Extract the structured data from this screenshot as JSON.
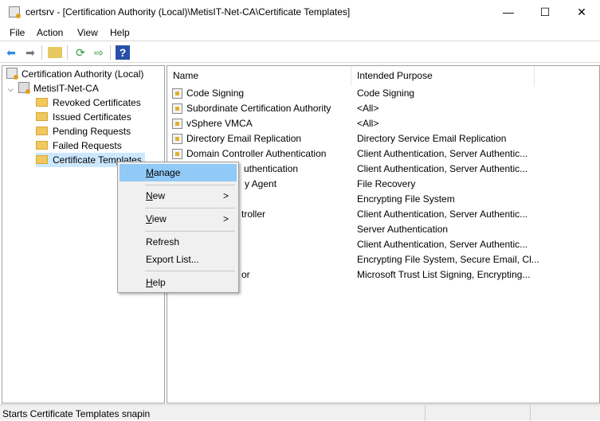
{
  "window": {
    "title": "certsrv - [Certification Authority (Local)\\MetisIT-Net-CA\\Certificate Templates]",
    "minimize": "—",
    "maximize": "☐",
    "close": "✕"
  },
  "menubar": [
    "File",
    "Action",
    "View",
    "Help"
  ],
  "toolbar": {
    "icons": [
      "back-icon",
      "forward-icon",
      "up-folder-icon",
      "refresh-icon",
      "export-icon",
      "help-icon"
    ]
  },
  "tree": {
    "root": "Certification Authority (Local)",
    "ca": "MetisIT-Net-CA",
    "items": [
      "Revoked Certificates",
      "Issued Certificates",
      "Pending Requests",
      "Failed Requests",
      "Certificate Templates"
    ]
  },
  "list": {
    "columns": [
      "Name",
      "Intended Purpose"
    ],
    "rows": [
      {
        "name": "Code Signing",
        "purpose": "Code Signing"
      },
      {
        "name": "Subordinate Certification Authority",
        "purpose": "<All>"
      },
      {
        "name": "vSphere VMCA",
        "purpose": "<All>"
      },
      {
        "name": "Directory Email Replication",
        "purpose": "Directory Service Email Replication"
      },
      {
        "name": "Domain Controller Authentication",
        "purpose": "Client Authentication, Server Authentic..."
      },
      {
        "name": "uthentication",
        "purpose": "Client Authentication, Server Authentic..."
      },
      {
        "name": "y Agent",
        "purpose": "File Recovery"
      },
      {
        "name": "",
        "purpose": "Encrypting File System"
      },
      {
        "name": "troller",
        "purpose": "Client Authentication, Server Authentic..."
      },
      {
        "name": "",
        "purpose": "Server Authentication"
      },
      {
        "name": "",
        "purpose": "Client Authentication, Server Authentic..."
      },
      {
        "name": "",
        "purpose": "Encrypting File System, Secure Email, Cl..."
      },
      {
        "name": "or",
        "purpose": "Microsoft Trust List Signing, Encrypting..."
      }
    ]
  },
  "context_menu": {
    "manage": "Manage",
    "new": "New",
    "view": "View",
    "refresh": "Refresh",
    "export": "Export List...",
    "help": "Help",
    "submenu_arrow": ">"
  },
  "status": "Starts Certificate Templates snapin",
  "colors": {
    "highlight": "#91c9f7",
    "tree_selected": "#cce8ff"
  }
}
